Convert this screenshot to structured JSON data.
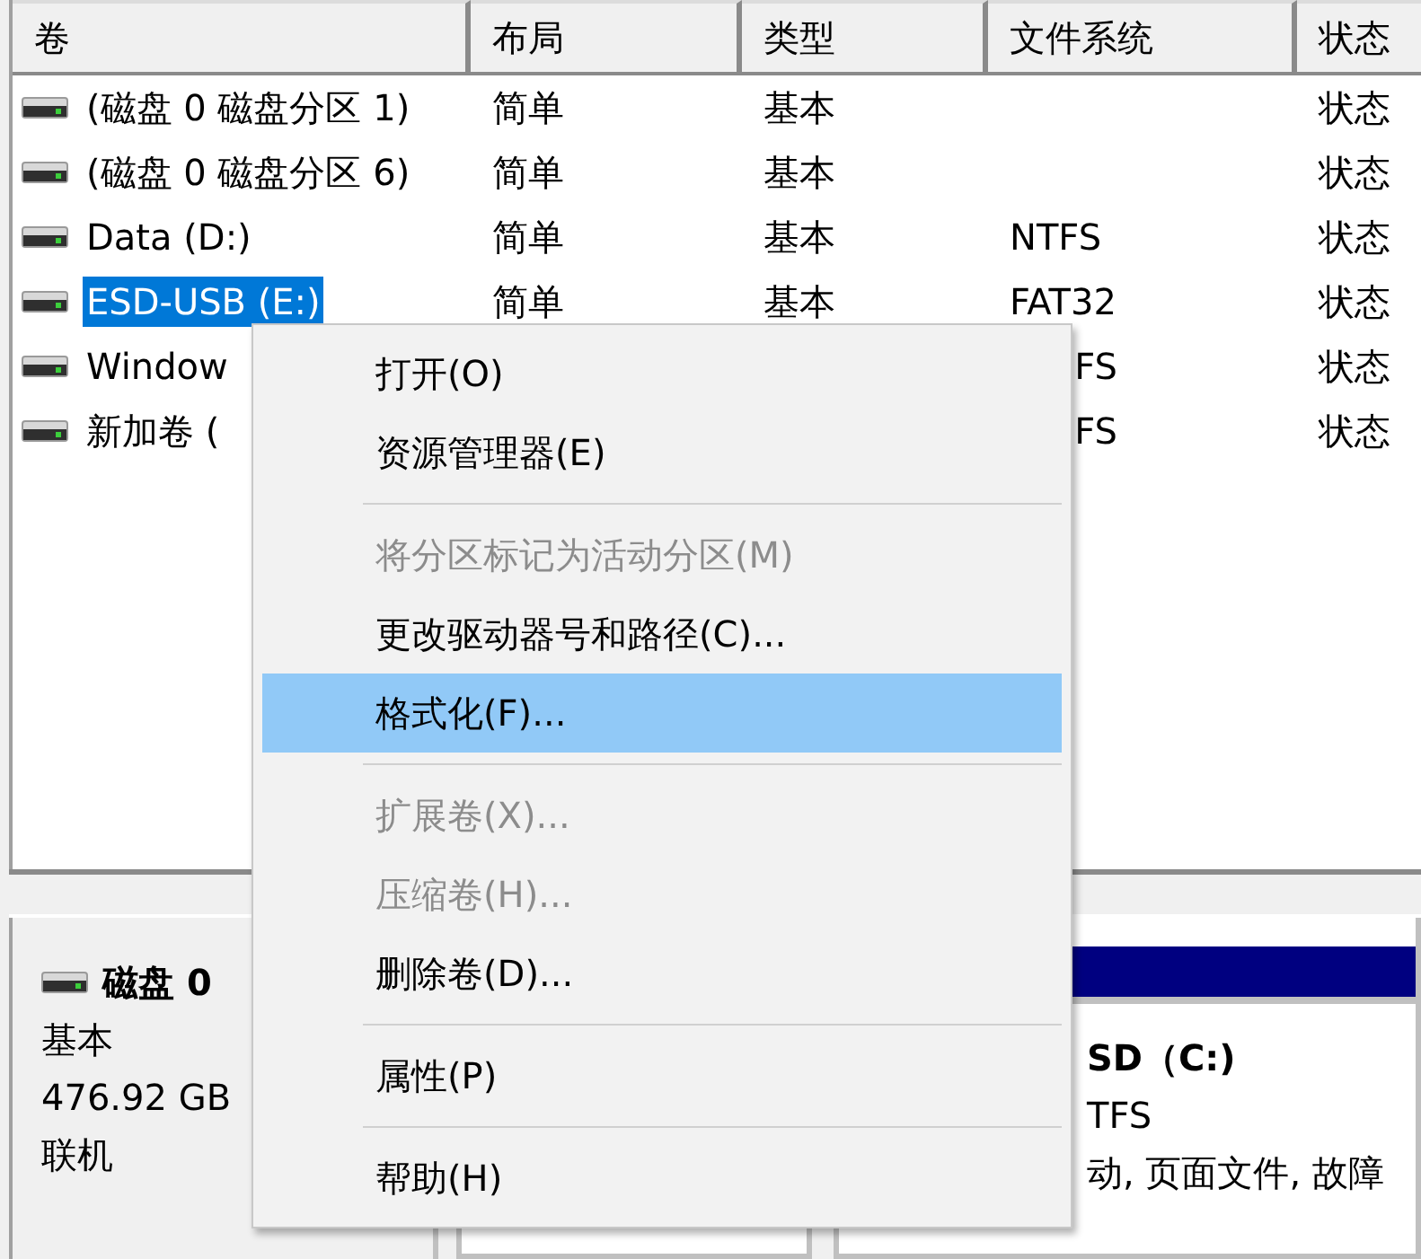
{
  "table": {
    "columns": [
      "卷",
      "布局",
      "类型",
      "文件系统",
      "状态"
    ],
    "rows": [
      {
        "volume": "(磁盘 0 磁盘分区 1)",
        "layout": "简单",
        "type": "基本",
        "status": "状态",
        "selected": false
      },
      {
        "volume": "(磁盘 0 磁盘分区 6)",
        "layout": "简单",
        "type": "基本",
        "status": "状态",
        "selected": false
      },
      {
        "volume": "Data (D:)",
        "layout": "简单",
        "type": "基本",
        "file_system": "NTFS",
        "status": "状态",
        "selected": false
      },
      {
        "volume": "ESD-USB (E:)",
        "layout": "简单",
        "type": "基本",
        "file_system": "FAT32",
        "status": "状态",
        "selected": true
      },
      {
        "volume": "Window",
        "file_system": "FS",
        "status": "状态",
        "selected": false
      },
      {
        "volume": "新加卷 (",
        "file_system": "FS",
        "status": "状态",
        "selected": false
      }
    ]
  },
  "disk": {
    "name": "磁盘 0",
    "type": "基本",
    "size": "476.92 GB",
    "status": "联机"
  },
  "partitions": [
    {
      "kind": "empty"
    },
    {
      "kind": "primary",
      "name": "SD（C:)",
      "file_system": "TFS",
      "status": "动, 页面文件, 故障"
    }
  ],
  "context_menu": [
    {
      "kind": "item",
      "label": "打开(O)",
      "disabled": false,
      "selected": false
    },
    {
      "kind": "item",
      "label": "资源管理器(E)",
      "disabled": false,
      "selected": false
    },
    {
      "kind": "separator"
    },
    {
      "kind": "item",
      "label": "将分区标记为活动分区(M)",
      "disabled": true,
      "selected": false
    },
    {
      "kind": "item",
      "label": "更改驱动器号和路径(C)...",
      "disabled": false,
      "selected": false
    },
    {
      "kind": "item",
      "label": "格式化(F)...",
      "disabled": false,
      "selected": true
    },
    {
      "kind": "separator"
    },
    {
      "kind": "item",
      "label": "扩展卷(X)...",
      "disabled": true,
      "selected": false
    },
    {
      "kind": "item",
      "label": "压缩卷(H)...",
      "disabled": true,
      "selected": false
    },
    {
      "kind": "item",
      "label": "删除卷(D)...",
      "disabled": false,
      "selected": false
    },
    {
      "kind": "separator"
    },
    {
      "kind": "item",
      "label": "属性(P)",
      "disabled": false,
      "selected": false
    },
    {
      "kind": "separator"
    },
    {
      "kind": "item",
      "label": "帮助(H)",
      "disabled": false,
      "selected": false
    }
  ]
}
